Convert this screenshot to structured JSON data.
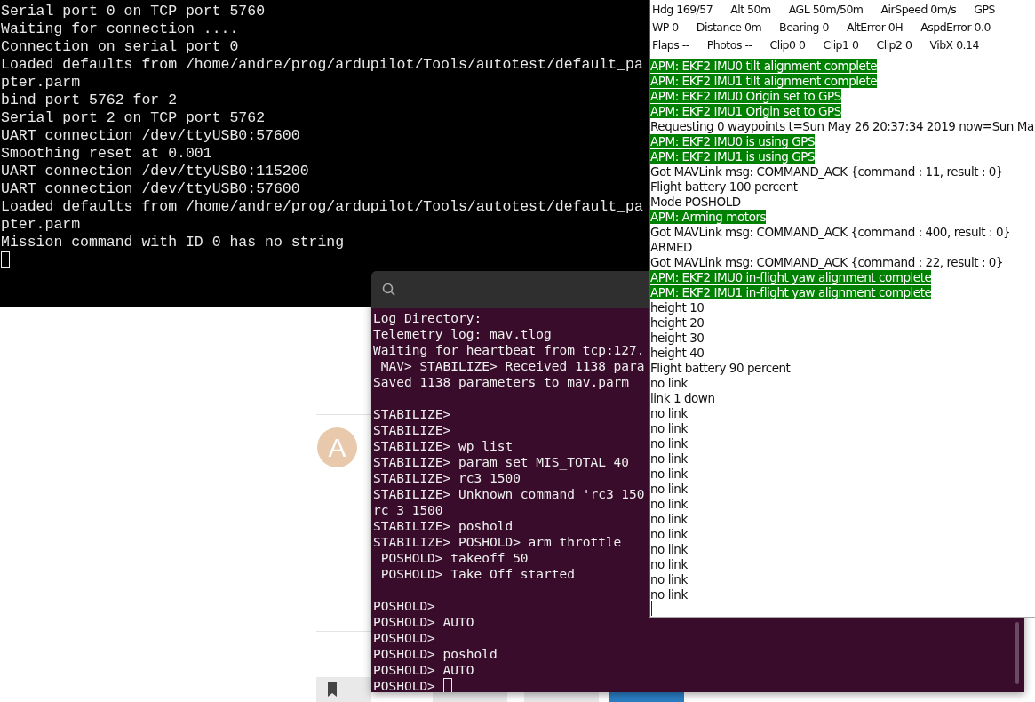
{
  "sim_terminal": {
    "lines": [
      "Serial port 0 on TCP port 5760",
      "Waiting for connection ....",
      "Connection on serial port 0",
      "Loaded defaults from /home/andre/prog/ardupilot/Tools/autotest/default_pa",
      "pter.parm",
      "bind port 5762 for 2",
      "Serial port 2 on TCP port 5762",
      "UART connection /dev/ttyUSB0:57600",
      "Smoothing reset at 0.001",
      "UART connection /dev/ttyUSB0:115200",
      "UART connection /dev/ttyUSB0:57600",
      "Loaded defaults from /home/andre/prog/ardupilot/Tools/autotest/default_pa",
      "pter.parm",
      "Mission command with ID 0 has no string"
    ]
  },
  "web_page": {
    "avatar": "A",
    "actions": [
      {
        "kind": "bookmark"
      },
      {
        "kind": "plain"
      },
      {
        "kind": "plain"
      },
      {
        "kind": "primary"
      }
    ]
  },
  "mavproxy_terminal": {
    "blocks": [
      [
        "Log Directory:",
        "Telemetry log: mav.tlog",
        "Waiting for heartbeat from tcp:127.",
        " MAV> STABILIZE> Received 1138 para",
        "Saved 1138 parameters to mav.parm"
      ],
      [
        "STABILIZE>",
        "STABILIZE>",
        "STABILIZE> wp list",
        "STABILIZE> param set MIS_TOTAL 40",
        "STABILIZE> rc3 1500",
        "STABILIZE> Unknown command 'rc3 150",
        "rc 3 1500",
        "STABILIZE> poshold",
        "STABILIZE> POSHOLD> arm throttle",
        " POSHOLD> takeoff 50",
        " POSHOLD> Take Off started"
      ],
      [
        "POSHOLD>",
        "POSHOLD> AUTO",
        "POSHOLD>",
        "POSHOLD> poshold",
        "POSHOLD> AUTO",
        "POSHOLD>"
      ]
    ]
  },
  "console": {
    "status_rows": [
      [
        "Hdg 169/57",
        "Alt 50m",
        "AGL 50m/50m",
        "AirSpeed 0m/s",
        "GPS"
      ],
      [
        "WP 0",
        "Distance 0m",
        "Bearing 0",
        "AltError 0H",
        "AspdError 0.0"
      ],
      [
        "Flaps --",
        "Photos --",
        "Clip0 0",
        "Clip1 0",
        "Clip2 0",
        "VibX 0.14"
      ]
    ],
    "log": [
      {
        "text": "APM: EKF2 IMU0 tilt alignment complete",
        "highlight": true
      },
      {
        "text": "APM: EKF2 IMU1 tilt alignment complete",
        "highlight": true
      },
      {
        "text": "APM: EKF2 IMU0 Origin set to GPS",
        "highlight": true
      },
      {
        "text": "APM: EKF2 IMU1 Origin set to GPS",
        "highlight": true
      },
      {
        "text": "Requesting 0 waypoints t=Sun May 26 20:37:34 2019 now=Sun Ma",
        "highlight": false
      },
      {
        "text": "APM: EKF2 IMU0 is using GPS",
        "highlight": true
      },
      {
        "text": "APM: EKF2 IMU1 is using GPS",
        "highlight": true
      },
      {
        "text": "Got MAVLink msg: COMMAND_ACK {command : 11, result : 0}",
        "highlight": false
      },
      {
        "text": "Flight battery 100 percent",
        "highlight": false
      },
      {
        "text": "Mode POSHOLD",
        "highlight": false
      },
      {
        "text": "APM: Arming motors",
        "highlight": true
      },
      {
        "text": "Got MAVLink msg: COMMAND_ACK {command : 400, result : 0}",
        "highlight": false
      },
      {
        "text": "ARMED",
        "highlight": false
      },
      {
        "text": "Got MAVLink msg: COMMAND_ACK {command : 22, result : 0}",
        "highlight": false
      },
      {
        "text": "APM: EKF2 IMU0 in-flight yaw alignment complete",
        "highlight": true
      },
      {
        "text": "APM: EKF2 IMU1 in-flight yaw alignment complete",
        "highlight": true
      },
      {
        "text": "height 10",
        "highlight": false
      },
      {
        "text": "height 20",
        "highlight": false
      },
      {
        "text": "height 30",
        "highlight": false
      },
      {
        "text": "height 40",
        "highlight": false
      },
      {
        "text": "Flight battery 90 percent",
        "highlight": false
      },
      {
        "text": "no link",
        "highlight": false
      },
      {
        "text": "link 1 down",
        "highlight": false
      },
      {
        "text": "no link",
        "highlight": false
      },
      {
        "text": "no link",
        "highlight": false
      },
      {
        "text": "no link",
        "highlight": false
      },
      {
        "text": "no link",
        "highlight": false
      },
      {
        "text": "no link",
        "highlight": false
      },
      {
        "text": "no link",
        "highlight": false
      },
      {
        "text": "no link",
        "highlight": false
      },
      {
        "text": "no link",
        "highlight": false
      },
      {
        "text": "no link",
        "highlight": false
      },
      {
        "text": "no link",
        "highlight": false
      },
      {
        "text": "no link",
        "highlight": false
      },
      {
        "text": "no link",
        "highlight": false
      },
      {
        "text": "no link",
        "highlight": false
      }
    ]
  }
}
